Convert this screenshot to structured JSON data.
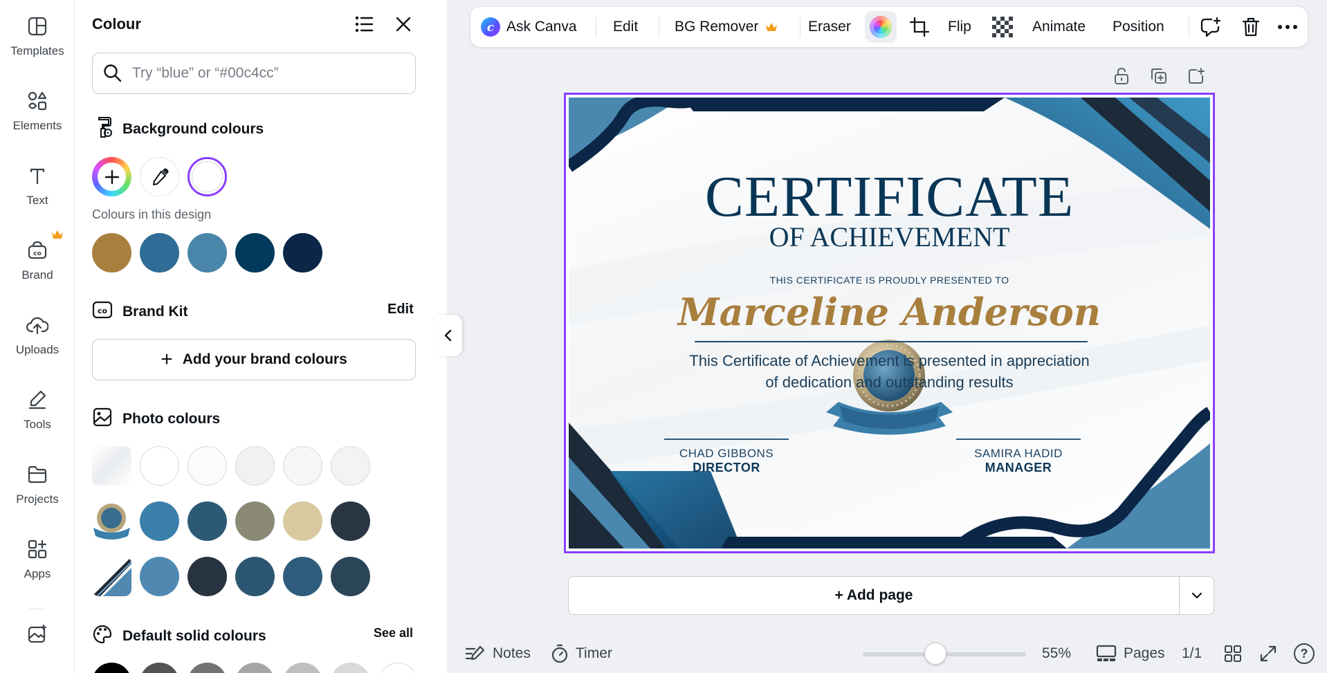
{
  "rail": {
    "items": [
      {
        "label": "Templates",
        "icon": "templates-icon"
      },
      {
        "label": "Elements",
        "icon": "elements-icon"
      },
      {
        "label": "Text",
        "icon": "text-icon"
      },
      {
        "label": "Brand",
        "icon": "brand-icon"
      },
      {
        "label": "Uploads",
        "icon": "uploads-icon"
      },
      {
        "label": "Tools",
        "icon": "tools-icon"
      },
      {
        "label": "Projects",
        "icon": "projects-icon"
      },
      {
        "label": "Apps",
        "icon": "apps-icon"
      }
    ]
  },
  "panel": {
    "title": "Colour",
    "search_placeholder": "Try “blue” or “#00c4cc”",
    "background": {
      "title": "Background colours",
      "selected_swatch": "#ffffff"
    },
    "design_colours": {
      "label": "Colours in this design",
      "swatches": [
        "#a97f3e",
        "#2f6d96",
        "#4a86aa",
        "#013a5c",
        "#0b2646"
      ]
    },
    "brand_kit": {
      "title": "Brand Kit",
      "edit_label": "Edit",
      "add_label": "Add your brand colours"
    },
    "photo_colours": {
      "title": "Photo colours",
      "rows": [
        [
          "#ffffff",
          "#fbfbfb",
          "#f1f1f1",
          "#f6f6f6",
          "#f3f3f3"
        ],
        [
          "#3b7fab",
          "#2c5a75",
          "#8a8a76",
          "#d8c9a0",
          "#2a3644"
        ],
        [
          "#4f89b1",
          "#273340",
          "#2c5672",
          "#2f5c7c",
          "#2a4558"
        ]
      ]
    },
    "default_colours": {
      "title": "Default solid colours",
      "see_all": "See all",
      "swatches": [
        "#000000",
        "#545454",
        "#737373",
        "#a6a6a6",
        "#bfbfbf",
        "#d9d9d9",
        "#ffffff"
      ]
    }
  },
  "toolbar": {
    "ask_canva": "Ask Canva",
    "edit": "Edit",
    "bg_remover": "BG Remover",
    "eraser": "Eraser",
    "flip": "Flip",
    "animate": "Animate",
    "position": "Position"
  },
  "certificate": {
    "title": "CERTIFICATE",
    "subtitle": "OF ACHIEVEMENT",
    "presented": "THIS CERTIFICATE IS PROUDLY PRESENTED TO",
    "name": "Marceline Anderson",
    "body_line1": "This Certificate of Achievement is presented in appreciation",
    "body_line2": "of dedication and outstanding results",
    "sig1_name": "CHAD GIBBONS",
    "sig1_role": "DIRECTOR",
    "sig2_name": "SAMIRA HADID",
    "sig2_role": "MANAGER"
  },
  "add_page_label": "+ Add page",
  "bottom_bar": {
    "notes": "Notes",
    "timer": "Timer",
    "zoom": "55%",
    "zoom_level": 0.55,
    "pages": "Pages",
    "page_count": "1/1",
    "help": "?"
  },
  "colors": {
    "accent": "#8b3dff",
    "crown": "#f2a01b",
    "navy": "#0a3656",
    "gold": "#a97f3e"
  }
}
